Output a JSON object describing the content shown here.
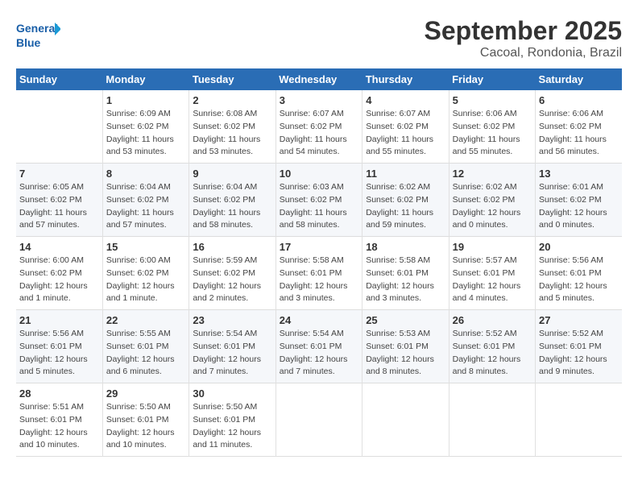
{
  "logo": {
    "text1": "General",
    "text2": "Blue"
  },
  "title": "September 2025",
  "subtitle": "Cacoal, Rondonia, Brazil",
  "weekdays": [
    "Sunday",
    "Monday",
    "Tuesday",
    "Wednesday",
    "Thursday",
    "Friday",
    "Saturday"
  ],
  "weeks": [
    [
      {
        "day": "",
        "sunrise": "",
        "sunset": "",
        "daylight": ""
      },
      {
        "day": "1",
        "sunrise": "Sunrise: 6:09 AM",
        "sunset": "Sunset: 6:02 PM",
        "daylight": "Daylight: 11 hours and 53 minutes."
      },
      {
        "day": "2",
        "sunrise": "Sunrise: 6:08 AM",
        "sunset": "Sunset: 6:02 PM",
        "daylight": "Daylight: 11 hours and 53 minutes."
      },
      {
        "day": "3",
        "sunrise": "Sunrise: 6:07 AM",
        "sunset": "Sunset: 6:02 PM",
        "daylight": "Daylight: 11 hours and 54 minutes."
      },
      {
        "day": "4",
        "sunrise": "Sunrise: 6:07 AM",
        "sunset": "Sunset: 6:02 PM",
        "daylight": "Daylight: 11 hours and 55 minutes."
      },
      {
        "day": "5",
        "sunrise": "Sunrise: 6:06 AM",
        "sunset": "Sunset: 6:02 PM",
        "daylight": "Daylight: 11 hours and 55 minutes."
      },
      {
        "day": "6",
        "sunrise": "Sunrise: 6:06 AM",
        "sunset": "Sunset: 6:02 PM",
        "daylight": "Daylight: 11 hours and 56 minutes."
      }
    ],
    [
      {
        "day": "7",
        "sunrise": "Sunrise: 6:05 AM",
        "sunset": "Sunset: 6:02 PM",
        "daylight": "Daylight: 11 hours and 57 minutes."
      },
      {
        "day": "8",
        "sunrise": "Sunrise: 6:04 AM",
        "sunset": "Sunset: 6:02 PM",
        "daylight": "Daylight: 11 hours and 57 minutes."
      },
      {
        "day": "9",
        "sunrise": "Sunrise: 6:04 AM",
        "sunset": "Sunset: 6:02 PM",
        "daylight": "Daylight: 11 hours and 58 minutes."
      },
      {
        "day": "10",
        "sunrise": "Sunrise: 6:03 AM",
        "sunset": "Sunset: 6:02 PM",
        "daylight": "Daylight: 11 hours and 58 minutes."
      },
      {
        "day": "11",
        "sunrise": "Sunrise: 6:02 AM",
        "sunset": "Sunset: 6:02 PM",
        "daylight": "Daylight: 11 hours and 59 minutes."
      },
      {
        "day": "12",
        "sunrise": "Sunrise: 6:02 AM",
        "sunset": "Sunset: 6:02 PM",
        "daylight": "Daylight: 12 hours and 0 minutes."
      },
      {
        "day": "13",
        "sunrise": "Sunrise: 6:01 AM",
        "sunset": "Sunset: 6:02 PM",
        "daylight": "Daylight: 12 hours and 0 minutes."
      }
    ],
    [
      {
        "day": "14",
        "sunrise": "Sunrise: 6:00 AM",
        "sunset": "Sunset: 6:02 PM",
        "daylight": "Daylight: 12 hours and 1 minute."
      },
      {
        "day": "15",
        "sunrise": "Sunrise: 6:00 AM",
        "sunset": "Sunset: 6:02 PM",
        "daylight": "Daylight: 12 hours and 1 minute."
      },
      {
        "day": "16",
        "sunrise": "Sunrise: 5:59 AM",
        "sunset": "Sunset: 6:02 PM",
        "daylight": "Daylight: 12 hours and 2 minutes."
      },
      {
        "day": "17",
        "sunrise": "Sunrise: 5:58 AM",
        "sunset": "Sunset: 6:01 PM",
        "daylight": "Daylight: 12 hours and 3 minutes."
      },
      {
        "day": "18",
        "sunrise": "Sunrise: 5:58 AM",
        "sunset": "Sunset: 6:01 PM",
        "daylight": "Daylight: 12 hours and 3 minutes."
      },
      {
        "day": "19",
        "sunrise": "Sunrise: 5:57 AM",
        "sunset": "Sunset: 6:01 PM",
        "daylight": "Daylight: 12 hours and 4 minutes."
      },
      {
        "day": "20",
        "sunrise": "Sunrise: 5:56 AM",
        "sunset": "Sunset: 6:01 PM",
        "daylight": "Daylight: 12 hours and 5 minutes."
      }
    ],
    [
      {
        "day": "21",
        "sunrise": "Sunrise: 5:56 AM",
        "sunset": "Sunset: 6:01 PM",
        "daylight": "Daylight: 12 hours and 5 minutes."
      },
      {
        "day": "22",
        "sunrise": "Sunrise: 5:55 AM",
        "sunset": "Sunset: 6:01 PM",
        "daylight": "Daylight: 12 hours and 6 minutes."
      },
      {
        "day": "23",
        "sunrise": "Sunrise: 5:54 AM",
        "sunset": "Sunset: 6:01 PM",
        "daylight": "Daylight: 12 hours and 7 minutes."
      },
      {
        "day": "24",
        "sunrise": "Sunrise: 5:54 AM",
        "sunset": "Sunset: 6:01 PM",
        "daylight": "Daylight: 12 hours and 7 minutes."
      },
      {
        "day": "25",
        "sunrise": "Sunrise: 5:53 AM",
        "sunset": "Sunset: 6:01 PM",
        "daylight": "Daylight: 12 hours and 8 minutes."
      },
      {
        "day": "26",
        "sunrise": "Sunrise: 5:52 AM",
        "sunset": "Sunset: 6:01 PM",
        "daylight": "Daylight: 12 hours and 8 minutes."
      },
      {
        "day": "27",
        "sunrise": "Sunrise: 5:52 AM",
        "sunset": "Sunset: 6:01 PM",
        "daylight": "Daylight: 12 hours and 9 minutes."
      }
    ],
    [
      {
        "day": "28",
        "sunrise": "Sunrise: 5:51 AM",
        "sunset": "Sunset: 6:01 PM",
        "daylight": "Daylight: 12 hours and 10 minutes."
      },
      {
        "day": "29",
        "sunrise": "Sunrise: 5:50 AM",
        "sunset": "Sunset: 6:01 PM",
        "daylight": "Daylight: 12 hours and 10 minutes."
      },
      {
        "day": "30",
        "sunrise": "Sunrise: 5:50 AM",
        "sunset": "Sunset: 6:01 PM",
        "daylight": "Daylight: 12 hours and 11 minutes."
      },
      {
        "day": "",
        "sunrise": "",
        "sunset": "",
        "daylight": ""
      },
      {
        "day": "",
        "sunrise": "",
        "sunset": "",
        "daylight": ""
      },
      {
        "day": "",
        "sunrise": "",
        "sunset": "",
        "daylight": ""
      },
      {
        "day": "",
        "sunrise": "",
        "sunset": "",
        "daylight": ""
      }
    ]
  ]
}
